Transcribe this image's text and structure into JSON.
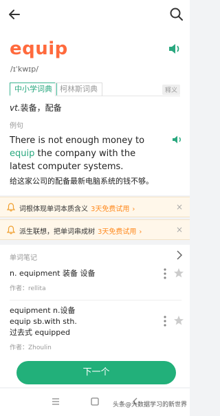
{
  "header": {
    "back_icon": "arrow-left-icon",
    "search_icon": "search-icon"
  },
  "entry": {
    "word": "equip",
    "phonetic": "/ɪˈkwɪp/",
    "accent_color": "#ff6a3d",
    "tabs": [
      {
        "label": "中小学词典",
        "active": true
      },
      {
        "label": "柯林斯词典",
        "active": false
      }
    ],
    "tab_tag": "释义",
    "pos_abbr": "vt.",
    "definition": "装备，配备"
  },
  "example": {
    "label": "例句",
    "en_before": "There is not enough money to",
    "en_highlight": "equip",
    "en_after": "the company with the latest computer systems.",
    "zh": "给这家公司的配备最新电脑系统的钱不够。"
  },
  "banners": [
    {
      "text": "词根体现单词本质含义",
      "trial": "3天免费试用",
      "close": "×"
    },
    {
      "text": "派生联想，把单词串成树",
      "trial": "3天免费试用",
      "close": "×"
    }
  ],
  "notes": {
    "title": "单词笔记",
    "items": [
      {
        "lines": [
          "n. equipment 装备 设备"
        ],
        "author": "作者：rellita"
      },
      {
        "lines": [
          "equipment n.设备",
          "equip sb.with sth.",
          "过去式 equipped"
        ],
        "author": "作者：Zhoulin"
      }
    ]
  },
  "next_button": "下一个",
  "watermark": "头条@大数据学习的新世界",
  "colors": {
    "primary": "#22b07a",
    "highlight": "#2aa87f",
    "trial": "#ff8a1f"
  }
}
